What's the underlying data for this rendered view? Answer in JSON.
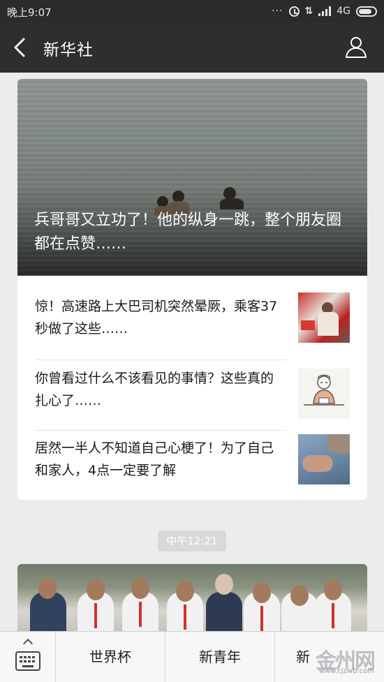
{
  "status_bar": {
    "time": "晚上9:07",
    "dots": "···",
    "network": "4G"
  },
  "header": {
    "title": "新华社"
  },
  "card_1": {
    "hero_title": "兵哥哥又立功了！他的纵身一跳，整个朋友圈都在点赞……",
    "items": [
      {
        "title": "惊！高速路上大巴司机突然晕厥，乘客37秒做了这些……"
      },
      {
        "title": "你曾看过什么不该看见的事情？这些真的扎心了……"
      },
      {
        "title": "居然一半人不知道自己心梗了！为了自己和家人，4点一定要了解"
      }
    ]
  },
  "time_badge": "中午12:21",
  "bottom_menu": {
    "items": [
      {
        "label": "世界杯"
      },
      {
        "label": "新青年"
      },
      {
        "label": "新"
      }
    ]
  },
  "watermark": {
    "text": "金州网",
    "url": "www.cjzwb.com"
  }
}
